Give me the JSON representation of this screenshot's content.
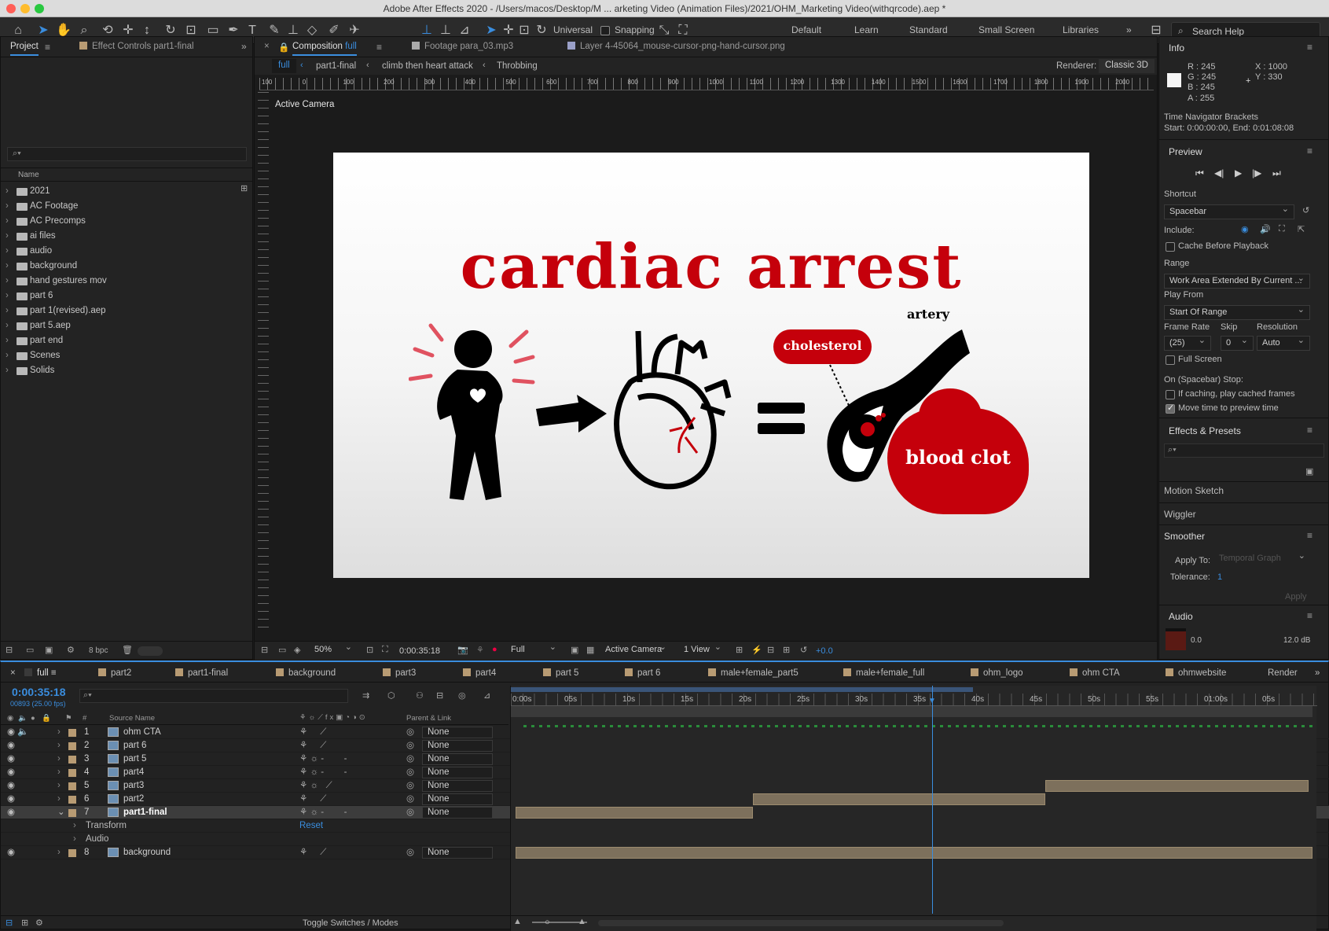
{
  "titlebar": {
    "title": "Adobe After Effects 2020 - /Users/macos/Desktop/M ... arketing Video (Animation Files)/2021/OHM_Marketing Video(withqrcode).aep *"
  },
  "toolbar": {
    "universal": "Universal",
    "snapping": "Snapping",
    "workspaces": [
      "Default",
      "Learn",
      "Standard",
      "Small Screen",
      "Libraries"
    ],
    "search_help": "Search Help"
  },
  "project": {
    "tab_project": "Project",
    "tab_effect_controls": "Effect Controls part1-final",
    "col_name": "Name",
    "items": [
      "2021",
      "AC Footage",
      "AC Precomps",
      "ai files",
      "audio",
      "background",
      "hand gestures mov",
      "part 6",
      "part 1(revised).aep",
      "part 5.aep",
      "part end",
      "Scenes",
      "Solids"
    ],
    "bpc": "8 bpc"
  },
  "composition": {
    "tab_comp_prefix": "Composition",
    "tab_comp_name": "full",
    "tab_footage": "Footage para_03.mp3",
    "tab_layer": "Layer 4-45064_mouse-cursor-png-hand-cursor.png",
    "breadcrumbs": [
      "full",
      "part1-final",
      "climb then heart attack",
      "Throbbing"
    ],
    "renderer_label": "Renderer:",
    "renderer_value": "Classic 3D",
    "ruler_labels": [
      "100",
      "0",
      "100",
      "200",
      "300",
      "400",
      "500",
      "600",
      "700",
      "800",
      "900",
      "1000",
      "1100",
      "1200",
      "1300",
      "1400",
      "1500",
      "1600",
      "1700",
      "1800",
      "1900",
      "2000"
    ],
    "active_camera": "Active Camera",
    "footer": {
      "zoom": "50%",
      "timecode": "0:00:35:18",
      "resolution": "Full",
      "camera": "Active Camera",
      "views": "1 View",
      "exposure": "+0.0"
    }
  },
  "artwork": {
    "headline": "cardiac arrest",
    "artery": "artery",
    "cholesterol": "cholesterol",
    "blood_clot": "blood clot",
    "red": "#c5000b"
  },
  "info": {
    "title": "Info",
    "r": "R :  245",
    "g": "G :  245",
    "b": "B :  245",
    "a": "A :  255",
    "x": "X : 1000",
    "y": "Y :  330",
    "brackets_title": "Time Navigator Brackets",
    "brackets_range": "Start: 0:00:00:00, End: 0:01:08:08"
  },
  "preview": {
    "title": "Preview",
    "shortcut_label": "Shortcut",
    "shortcut_value": "Spacebar",
    "include_label": "Include:",
    "cache_label": "Cache Before Playback",
    "range_label": "Range",
    "range_value": "Work Area Extended By Current ...",
    "play_from_label": "Play From",
    "play_from_value": "Start Of Range",
    "frame_rate_label": "Frame Rate",
    "skip_label": "Skip",
    "resolution_label": "Resolution",
    "frame_rate_value": "(25)",
    "skip_value": "0",
    "resolution_value": "Auto",
    "full_screen_label": "Full Screen",
    "on_stop_label": "On (Spacebar) Stop:",
    "if_caching_label": "If caching, play cached frames",
    "move_time_label": "Move time to preview time"
  },
  "effects": {
    "title": "Effects & Presets",
    "motion_sketch": "Motion Sketch",
    "wiggler": "Wiggler"
  },
  "smoother": {
    "title": "Smoother",
    "apply_to_label": "Apply To:",
    "apply_to_value": "Temporal Graph",
    "tolerance_label": "Tolerance:",
    "tolerance_value": "1",
    "apply_button": "Apply"
  },
  "audio": {
    "title": "Audio",
    "level_left": "0.0",
    "level_right": "12.0 dB"
  },
  "timeline": {
    "tabs": [
      "full",
      "part2",
      "part1-final",
      "background",
      "part3",
      "part4",
      "part 5",
      "part 6",
      "male+female_part5",
      "male+female_full",
      "ohm_logo",
      "ohm CTA",
      "ohmwebsite",
      "Render"
    ],
    "current_time": "0:00:35:18",
    "frame_info": "00893 (25.00 fps)",
    "col_source": "Source Name",
    "col_parent": "Parent & Link",
    "ruler": [
      "0:00s",
      "05s",
      "10s",
      "15s",
      "20s",
      "25s",
      "30s",
      "35s",
      "40s",
      "45s",
      "50s",
      "55s",
      "01:00s",
      "05s"
    ],
    "layers": [
      {
        "num": "1",
        "name": "ohm CTA",
        "parent": "None",
        "start": 1.0,
        "end": 1.0
      },
      {
        "num": "2",
        "name": "part 6",
        "parent": "None",
        "start": 1.0,
        "end": 1.0
      },
      {
        "num": "3",
        "name": "part 5",
        "parent": "None",
        "start": 1.0,
        "end": 1.0
      },
      {
        "num": "4",
        "name": "part4",
        "parent": "None",
        "start": 1.0,
        "end": 1.0
      },
      {
        "num": "5",
        "name": "part3",
        "parent": "None",
        "start": 0.665,
        "end": 0.995
      },
      {
        "num": "6",
        "name": "part2",
        "parent": "None",
        "start": 0.298,
        "end": 0.665
      },
      {
        "num": "7",
        "name": "part1-final",
        "parent": "None",
        "start": 0.0,
        "end": 0.298
      }
    ],
    "transform_label": "Transform",
    "reset_label": "Reset",
    "audio_label": "Audio",
    "background_layer": {
      "num": "8",
      "name": "background",
      "parent": "None"
    },
    "toggle_switches": "Toggle Switches / Modes"
  }
}
